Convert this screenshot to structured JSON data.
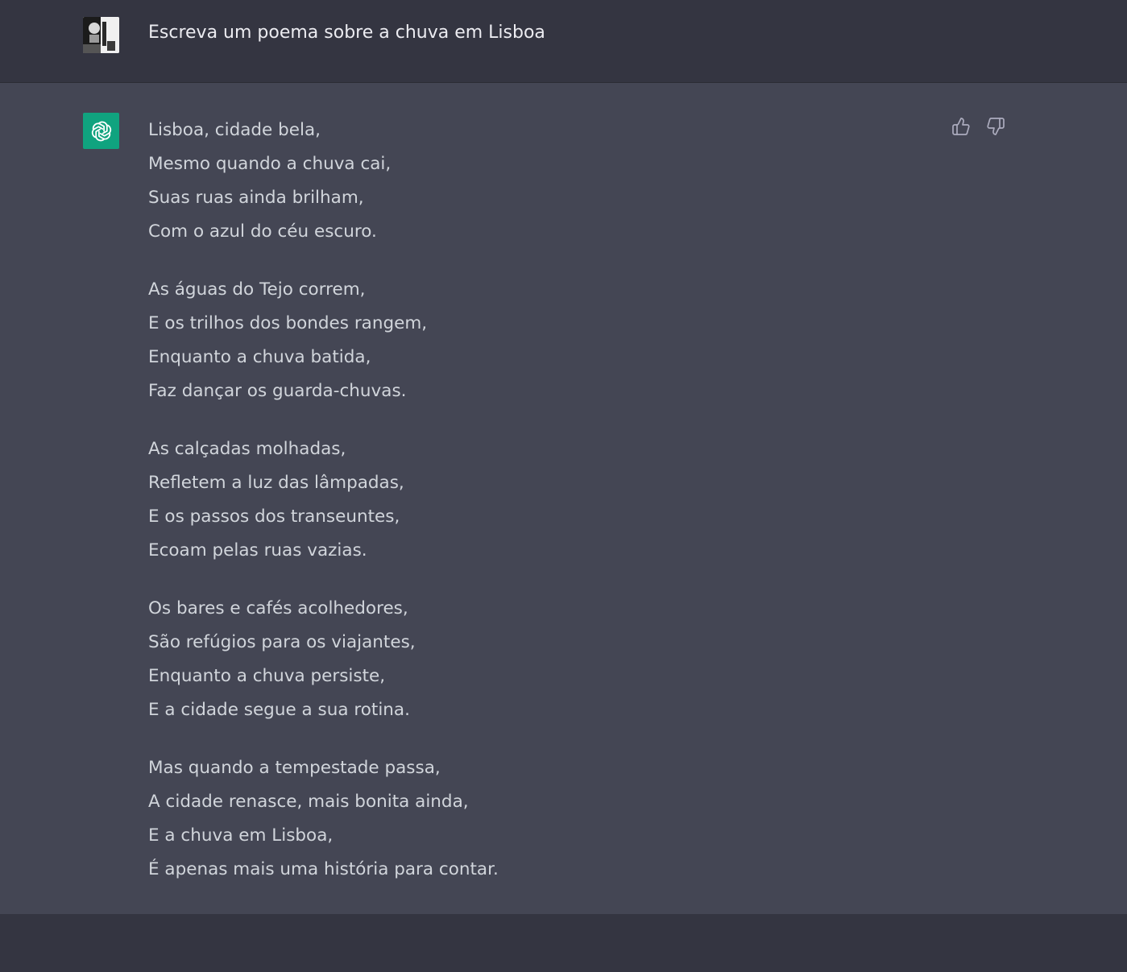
{
  "user_message": {
    "text": "Escreva um poema sobre a chuva em Lisboa"
  },
  "assistant_message": {
    "stanzas": [
      [
        "Lisboa, cidade bela,",
        "Mesmo quando a chuva cai,",
        "Suas ruas ainda brilham,",
        "Com o azul do céu escuro."
      ],
      [
        "As águas do Tejo correm,",
        "E os trilhos dos bondes rangem,",
        "Enquanto a chuva batida,",
        "Faz dançar os guarda-chuvas."
      ],
      [
        "As calçadas molhadas,",
        "Refletem a luz das lâmpadas,",
        "E os passos dos transeuntes,",
        "Ecoam pelas ruas vazias."
      ],
      [
        "Os bares e cafés acolhedores,",
        "São refúgios para os viajantes,",
        "Enquanto a chuva persiste,",
        "E a cidade segue a sua rotina."
      ],
      [
        "Mas quando a tempestade passa,",
        "A cidade renasce, mais bonita ainda,",
        "E a chuva em Lisboa,",
        "É apenas mais uma história para contar."
      ]
    ]
  },
  "icons": {
    "user_avatar": "user-avatar",
    "bot_avatar": "openai-logo-icon",
    "thumbs_up": "thumbs-up-icon",
    "thumbs_down": "thumbs-down-icon"
  },
  "colors": {
    "user_bg": "#343541",
    "assistant_bg": "#444654",
    "bot_accent": "#10a37f",
    "text": "#d1d5db"
  }
}
